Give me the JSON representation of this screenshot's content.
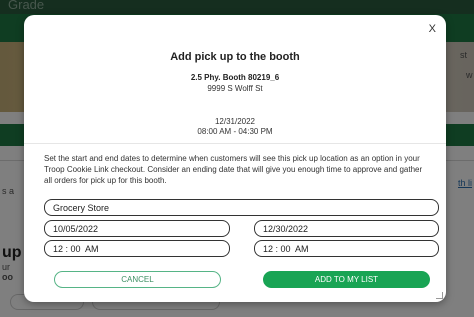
{
  "background": {
    "top_text": "Grade",
    "frag_left1": "s a",
    "frag_left2": "up",
    "frag_left3": "ur",
    "frag_left4": "oo",
    "frag_right_link": "th li",
    "frag_right2": "st",
    "frag_right3": "w"
  },
  "modal": {
    "close_label": "X",
    "title": "Add pick up to the booth",
    "booth_name": "2.5 Phy. Booth 80219_6",
    "booth_address": "9999 S Wolff St",
    "booth_date": "12/31/2022",
    "booth_time_range": "08:00 AM - 04:30 PM",
    "description": "Set the start and end dates to determine when customers will see this pick up location as an option in your Troop Cookie Link checkout. Consider an ending date that will give you enough time to approve and gather all orders for pick up for this booth.",
    "location_value": "Grocery Store",
    "start_date_value": "10/05/2022",
    "end_date_value": "12/30/2022",
    "start_time_value": "12 : 00  AM",
    "end_time_value": "12 : 00  AM",
    "cancel_label": "CANCEL",
    "add_label": "ADD TO MY LIST"
  },
  "colors": {
    "accent_green": "#19a454",
    "header_green": "#1e7a45",
    "overlay": "rgba(0,0,0,0.5)"
  }
}
